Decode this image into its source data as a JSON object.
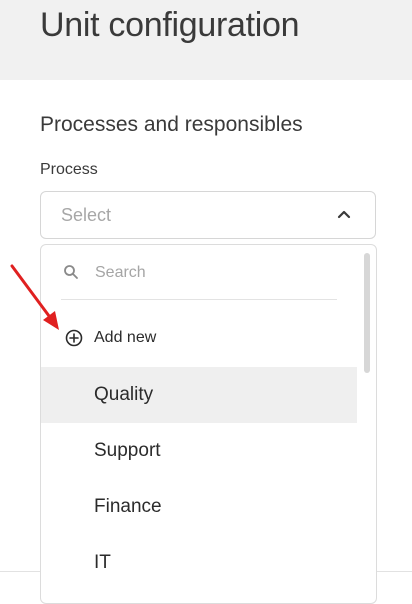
{
  "header": {
    "title": "Unit configuration"
  },
  "section": {
    "title": "Processes and responsibles"
  },
  "process_field": {
    "label": "Process",
    "placeholder": "Select",
    "chevron_icon": "chevron-up-icon"
  },
  "dropdown": {
    "search_placeholder": "Search",
    "search_icon": "search-icon",
    "add_new_label": "Add new",
    "add_new_icon": "plus-circle-icon",
    "options": [
      "Quality",
      "Support",
      "Finance",
      "IT"
    ],
    "highlighted_option": "Quality"
  },
  "annotation": {
    "arrow_color": "#e02020"
  }
}
